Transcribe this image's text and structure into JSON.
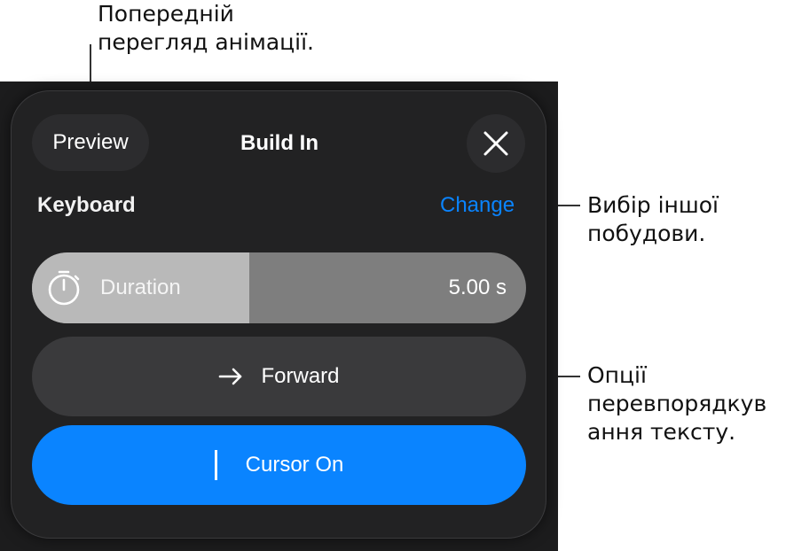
{
  "callouts": {
    "preview": [
      "Попередній",
      "перегляд анімації."
    ],
    "change": [
      "Вибір іншої",
      "побудови."
    ],
    "direction": [
      "Опції",
      "перевпорядкув",
      "ання тексту."
    ]
  },
  "header": {
    "preview_label": "Preview",
    "title": "Build In",
    "close_icon": "close-icon"
  },
  "effect": {
    "name": "Keyboard",
    "change_label": "Change"
  },
  "duration": {
    "label": "Duration",
    "value": "5.00 s",
    "fill_fraction": 0.44,
    "icon": "stopwatch-icon"
  },
  "direction": {
    "label": "Forward",
    "icon": "arrow-right-icon"
  },
  "cursor": {
    "label": "Cursor On",
    "state": "on"
  },
  "colors": {
    "accent": "#0a84ff",
    "panel": "#1c1c1d",
    "popover": "#222223",
    "duration_track": "#7e7e7e",
    "duration_fill": "#b9b9b9"
  }
}
